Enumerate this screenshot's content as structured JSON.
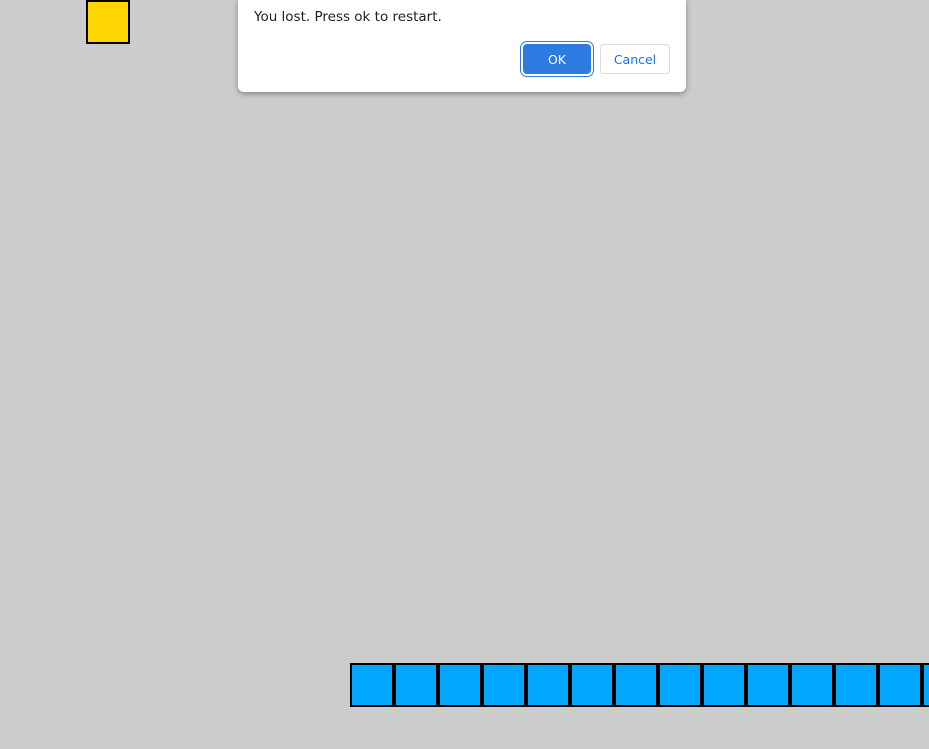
{
  "game": {
    "food_color": "#ffd500",
    "snake_color": "#00a8ff",
    "background_color": "#cccccc",
    "snake_visible_segments": 13
  },
  "dialog": {
    "message": "You lost. Press ok to restart.",
    "ok_label": "OK",
    "cancel_label": "Cancel"
  }
}
